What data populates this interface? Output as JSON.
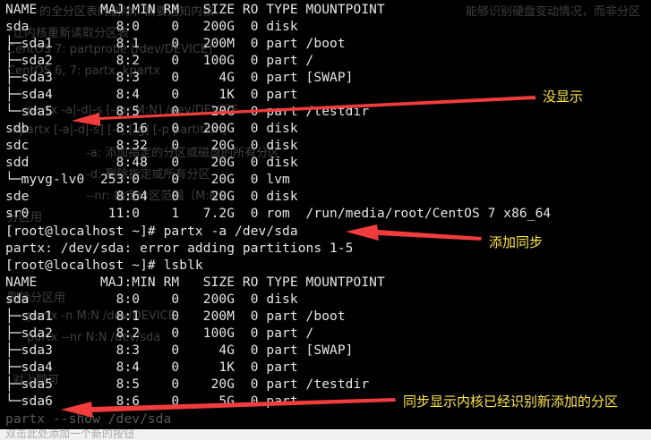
{
  "terminal": {
    "lines": [
      "NAME        MAJ:MIN RM   SIZE RO TYPE MOUNTPOINT",
      "sda           8:0    0   200G  0 disk",
      "├─sda1        8:1    0   200M  0 part /boot",
      "├─sda2        8:2    0   100G  0 part /",
      "├─sda3        8:3    0     4G  0 part [SWAP]",
      "├─sda4        8:4    0     1K  0 part",
      "└─sda5        8:5    0    20G  0 part /testdir",
      "sdb           8:16   0   200G  0 disk",
      "sdc           8:32   0    20G  0 disk",
      "sdd           8:48   0    20G  0 disk",
      "└─myvg-lv0  253:0    0    20G  0 lvm",
      "sde           8:64   0    20G  0 disk",
      "sr0          11:0    1   7.2G  0 rom  /run/media/root/CentOS 7 x86_64",
      "[root@localhost ~]# partx -a /dev/sda",
      "partx: /dev/sda: error adding partitions 1-5",
      "[root@localhost ~]# lsblk",
      "NAME        MAJ:MIN RM   SIZE RO TYPE MOUNTPOINT",
      "sda           8:0    0   200G  0 disk",
      "├─sda1        8:1    0   200M  0 part /boot",
      "├─sda2        8:2    0   100G  0 part /",
      "├─sda3        8:3    0     4G  0 part [SWAP]",
      "├─sda4        8:4    0     1K  0 part",
      "├─sda5        8:5    0    20G  0 part /testdir",
      "└─sda6        8:6    0     5G  0 part",
      "partx --show /dev/sda"
    ]
  },
  "annotations": {
    "not_shown": "没显示",
    "add_sync": "添加同步",
    "sync_kernel": "同步显示内核已经识别新添加的分区",
    "color": "#ffe64d",
    "arrow_color": "#f03c3c"
  },
  "ghost_text": [
    "的全分区表的删除，需要通知内核",
    "让内核重新读取分区表",
    "CentOS 7: partprobe [/dev/DEVICE]",
    "CentOS 6, 7: partx, kpartx",
    "partx -a|-d|-s [--nr M:N] /dev/DEVICE",
    "kpartx [-a|-d|-s] [-f] [-g] [-p partition]",
    "-a: 添加指定的分区或磁盘的所有分区",
    "-d: 删除指定或所有分区",
    "--nr: 指定分区范围（M:N）",
    "分区用",
    "删除分区用",
    "partx -n M:N /dev/DEVICE",
    "partx --nr N:N /dev/sda",
    "对上题可",
    "能够识别硬盘变动情况，而非分区"
  ],
  "bottom_bar": {
    "text": "双击此处添加一个新的按钮"
  }
}
